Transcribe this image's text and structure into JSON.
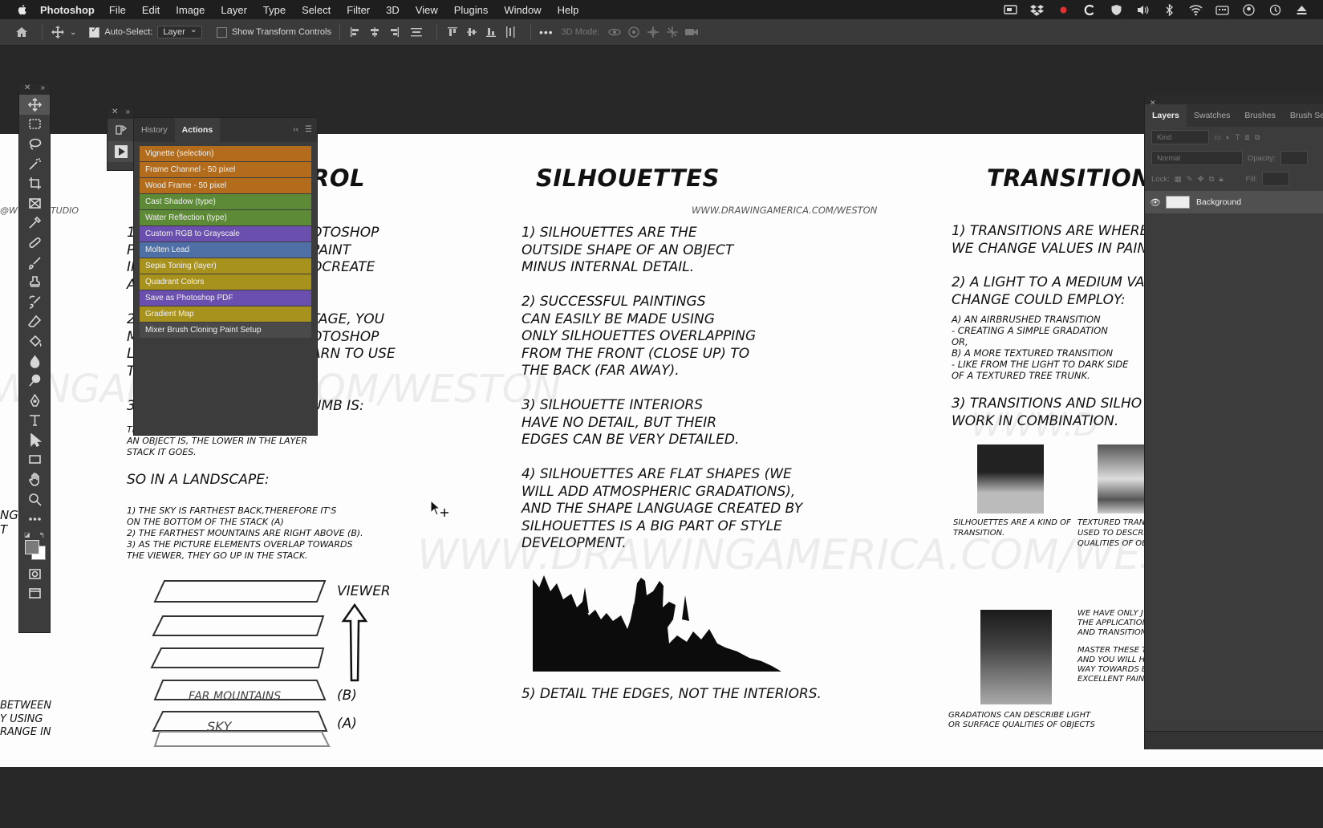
{
  "menubar": {
    "app": "Photoshop",
    "items": [
      "File",
      "Edit",
      "Image",
      "Layer",
      "Type",
      "Select",
      "Filter",
      "3D",
      "View",
      "Plugins",
      "Window",
      "Help"
    ]
  },
  "options": {
    "auto_select_label": "Auto-Select:",
    "auto_select_value": "Layer",
    "show_transform_label": "Show Transform Controls",
    "mode_label": "3D Mode:"
  },
  "actions_panel": {
    "tabs": [
      "History",
      "Actions"
    ],
    "items": [
      {
        "label": "Vignette (selection)",
        "color": "#b26c1c"
      },
      {
        "label": "Frame Channel - 50 pixel",
        "color": "#b26c1c"
      },
      {
        "label": "Wood Frame - 50 pixel",
        "color": "#b26c1c"
      },
      {
        "label": "Cast Shadow (type)",
        "color": "#5d8a37"
      },
      {
        "label": "Water Reflection (type)",
        "color": "#5d8a37"
      },
      {
        "label": "Custom RGB to Grayscale",
        "color": "#6a4fae"
      },
      {
        "label": "Molten Lead",
        "color": "#4f70a6"
      },
      {
        "label": "Sepia Toning (layer)",
        "color": "#a8921e"
      },
      {
        "label": "Quadrant Colors",
        "color": "#a8921e"
      },
      {
        "label": "Save as Photoshop PDF",
        "color": "#6a4fae"
      },
      {
        "label": "Gradient Map",
        "color": "#a8921e"
      },
      {
        "label": "Mixer Brush Cloning Paint Setup",
        "color": "#4a4a4a"
      }
    ]
  },
  "layers_panel": {
    "tabs": [
      "Layers",
      "Swatches",
      "Brushes",
      "Brush Se"
    ],
    "kind_placeholder": "Kind",
    "blend_mode": "Normal",
    "opacity_label": "Opacity:",
    "lock_label": "Lock:",
    "fill_label": "Fill:",
    "layer_name": "Background"
  },
  "canvas": {
    "left_col": {
      "title_fragment": "ROL",
      "edge_url": "@W        STONSTUDIO",
      "frag_1": "1)\nP\nIN\nA",
      "frag_1r": "OTOSHOP\n PAINT\nOCREATE",
      "frag_2": "2\nM\nL\nT",
      "frag_2r": "TAGE, YOU\nOTOSHOP\nARN TO USE",
      "frag_3": "3",
      "frag_3r": "UMB IS:",
      "frag_small": "TI\nAN OBJECT IS, THE LOWER IN THE LAYER\nSTACK IT GOES.",
      "landscape_title": "SO IN A LANDSCAPE:",
      "landscape_notes": "1) THE SKY IS FARTHEST BACK,THEREFORE IT'S\nON THE BOTTOM OF THE STACK (A)\n2) THE FARTHEST MOUNTAINS ARE RIGHT ABOVE (B).\n3) AS THE PICTURE ELEMENTS OVERLAP TOWARDS\nTHE VIEWER, THEY GO UP IN THE STACK.",
      "viewer": "VIEWER",
      "label_b": "(B)",
      "label_a": "(A)",
      "sketch_mountains": "FAR MOUNTAINS",
      "sketch_sky": "SKY",
      "edge_frag_1": "NG\nT",
      "edge_frag_2": "BETWEEN\nY USING\nRANGE IN"
    },
    "mid_col": {
      "title": "SILHOUETTES",
      "url": "WWW.DRAWINGAMERICA.COM/WESTON",
      "p1": "1) SILHOUETTES ARE THE\nOUTSIDE SHAPE OF AN OBJECT\nMINUS INTERNAL DETAIL.",
      "p2": "2) SUCCESSFUL PAINTINGS\nCAN EASILY BE MADE USING\nONLY SILHOUETTES OVERLAPPING\nFROM THE FRONT (CLOSE UP) TO\nTHE BACK (FAR AWAY).",
      "p3": "3) SILHOUETTE INTERIORS\nHAVE NO DETAIL, BUT THEIR\nEDGES CAN BE VERY DETAILED.",
      "p4": "4) SILHOUETTES ARE FLAT SHAPES (WE\nWILL ADD ATMOSPHERIC GRADATIONS),\nAND THE SHAPE LANGUAGE CREATED BY\nSILHOUETTES IS A BIG PART OF STYLE\nDEVELOPMENT.",
      "p5": "5) DETAIL THE EDGES, NOT THE INTERIORS."
    },
    "right_col": {
      "title": "TRANSITIONS",
      "p1": "1) TRANSITIONS ARE WHERE\nWE CHANGE VALUES IN PAIN",
      "p2": "2) A LIGHT TO A MEDIUM VA\nCHANGE COULD EMPLOY:",
      "sub": "   A) AN AIRBRUSHED TRANSITION\n    - CREATING A SIMPLE GRADATION\nOR,\n   B) A MORE TEXTURED TRANSITION\n    - LIKE FROM THE LIGHT TO DARK SIDE\n   OF A TEXTURED TREE TRUNK.",
      "p3": "3)  TRANSITIONS AND SILHO\nWORK IN COMBINATION.",
      "cap1": "SILHOUETTES ARE A KIND OF\nTRANSITION.",
      "cap2": "TEXTURED TRANS\nUSED TO DESCRI\nQUALITIES OF OB",
      "note1": "WE HAVE ONLY J\nTHE APPLICATION\nAND TRANSITION",
      "note2": "MASTER THESE T\nAND YOU WILL HA\nWAY TOWARDS B\nEXCELLENT PAINT",
      "cap3": "GRADATIONS CAN DESCRIBE LIGHT\nOR SURFACE QUALITIES OF OBJECTS"
    },
    "watermark_1": "WWW.DRAWINGAMERICA.COM/WESTON",
    "watermark_2": "WINGAMERICA.COM/WESTON",
    "watermark_3": "WWW.D"
  }
}
